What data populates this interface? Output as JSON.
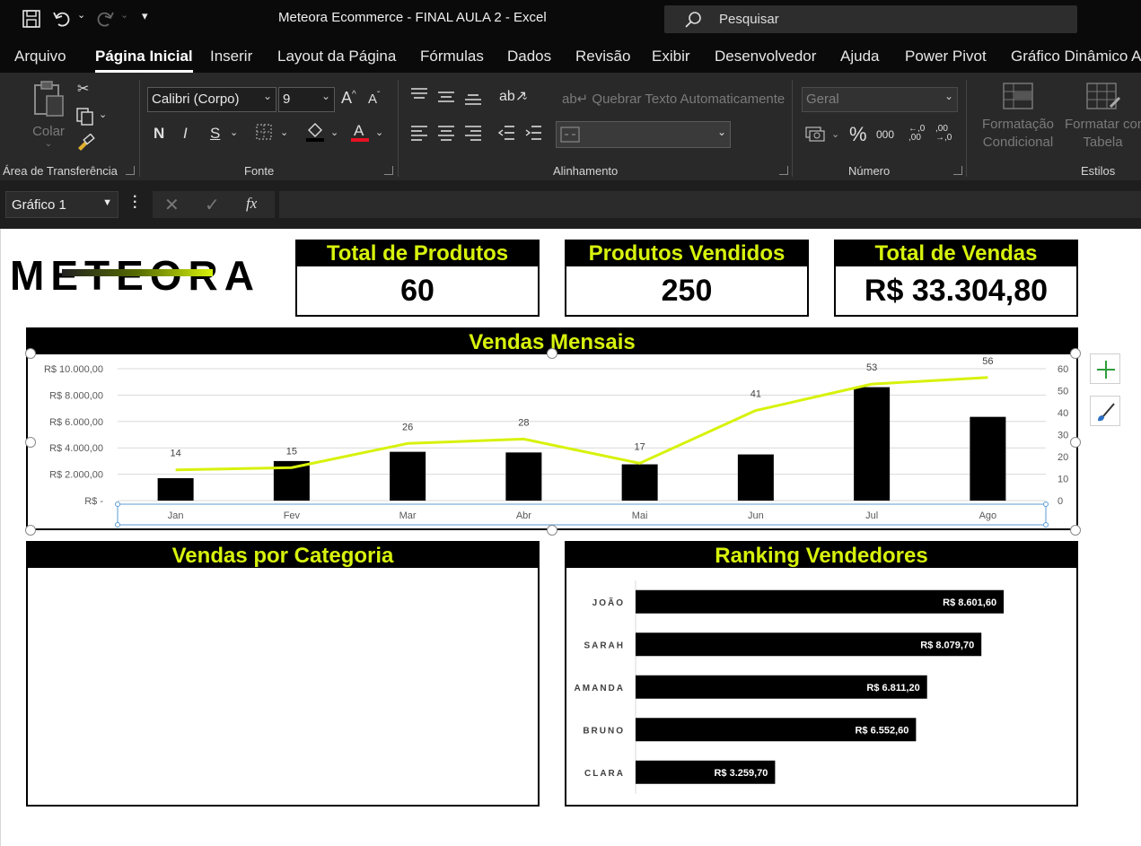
{
  "window": {
    "title": "Meteora Ecommerce - FINAL AULA 2  -  Excel",
    "search_placeholder": "Pesquisar"
  },
  "menu": {
    "tabs": [
      "Arquivo",
      "Página Inicial",
      "Inserir",
      "Layout da Página",
      "Fórmulas",
      "Dados",
      "Revisão",
      "Exibir",
      "Desenvolvedor",
      "Ajuda",
      "Power Pivot",
      "Gráfico Dinâmico A"
    ],
    "active": "Página Inicial"
  },
  "ribbon": {
    "clipboard": {
      "paste_label": "Colar",
      "group_label": "Área de Transferência"
    },
    "font": {
      "font_name": "Calibri (Corpo)",
      "font_size": "9",
      "bold": "N",
      "italic": "I",
      "underline": "S",
      "group_label": "Fonte"
    },
    "alignment": {
      "wrap_text": "Quebrar Texto Automaticamente",
      "group_label": "Alinhamento"
    },
    "number": {
      "format": "Geral",
      "percent": "%",
      "thousands": "000",
      "inc_decimal": ",00 ,0",
      "dec_decimal": ",00 ,0",
      "group_label": "Número"
    },
    "styles": {
      "cond_format_line1": "Formatação",
      "cond_format_line2": "Condicional",
      "format_table_line1": "Formatar como",
      "format_table_line2": "Tabela",
      "group_label": "Estilos"
    }
  },
  "formula_bar": {
    "name_box": "Gráfico 1",
    "fx": "fx",
    "content": ""
  },
  "dashboard": {
    "logo_text": "METEORA",
    "kpis": [
      {
        "title": "Total de Produtos",
        "value": "60"
      },
      {
        "title": "Produtos Vendidos",
        "value": "250"
      },
      {
        "title": "Total de Vendas",
        "value": "R$ 33.304,80"
      }
    ],
    "monthly_title": "Vendas Mensais",
    "category_title": "Vendas por Categoria",
    "ranking_title": "Ranking Vendedores"
  },
  "chart_data": [
    {
      "type": "bar",
      "title": "Vendas Mensais",
      "categories": [
        "Jan",
        "Fev",
        "Mar",
        "Abr",
        "Mai",
        "Jun",
        "Jul",
        "Ago"
      ],
      "series": [
        {
          "type": "bar",
          "axis": "left",
          "color": "#000000",
          "values": [
            1700,
            3000,
            3700,
            3650,
            2750,
            3500,
            8601.6,
            6350
          ]
        },
        {
          "type": "line",
          "axis": "right",
          "color": "#d7f20c",
          "values": [
            14,
            15,
            26,
            28,
            17,
            41,
            53,
            56
          ],
          "labels": [
            "14",
            "15",
            "26",
            "28",
            "17",
            "41",
            "53",
            "56"
          ]
        }
      ],
      "ylim": [
        0,
        10000
      ],
      "y_ticks": [
        "R$ -",
        "R$ 2.000,00",
        "R$ 4.000,00",
        "R$ 6.000,00",
        "R$ 8.000,00",
        "R$ 10.000,00"
      ],
      "y2lim": [
        0,
        60
      ],
      "y2_ticks": [
        "0",
        "10",
        "20",
        "30",
        "40",
        "50",
        "60"
      ],
      "grid": true
    },
    {
      "type": "bar",
      "orientation": "horizontal",
      "title": "Ranking Vendedores",
      "categories": [
        "JOÃO",
        "SARAH",
        "AMANDA",
        "BRUNO",
        "CLARA"
      ],
      "values": [
        8601.6,
        8079.7,
        6811.2,
        6552.6,
        3259.7
      ],
      "labels": [
        "R$ 8.601,60",
        "R$ 8.079,70",
        "R$ 6.811,20",
        "R$ 6.552,60",
        "R$ 3.259,70"
      ],
      "xlim": [
        0,
        10000
      ],
      "color": "#000000"
    }
  ]
}
